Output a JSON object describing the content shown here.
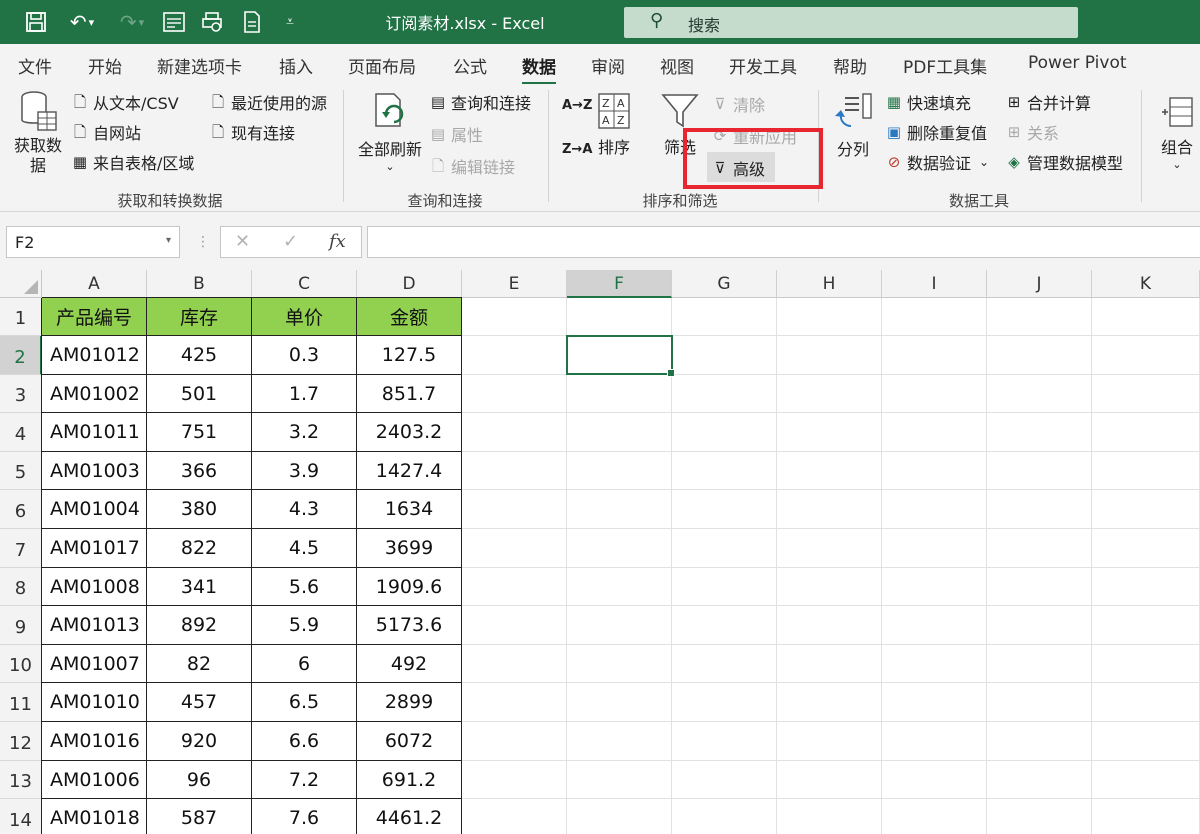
{
  "window": {
    "title": "订阅素材.xlsx - Excel",
    "search_placeholder": "搜索",
    "accent": "#217346"
  },
  "tabs": [
    "文件",
    "开始",
    "新建选项卡",
    "插入",
    "页面布局",
    "公式",
    "数据",
    "审阅",
    "视图",
    "开发工具",
    "帮助",
    "PDF工具集",
    "Power Pivot"
  ],
  "active_tab": "数据",
  "ribbon": {
    "get_data": {
      "big_label": "获取数据",
      "big_label_2": "据",
      "from_text": "从文本/CSV",
      "from_web": "自网站",
      "from_table": "来自表格/区域",
      "recent_sources": "最近使用的源",
      "existing_connections": "现有连接",
      "group_label": "获取和转换数据"
    },
    "queries": {
      "refresh_all": "全部刷新",
      "queries_connections": "查询和连接",
      "properties": "属性",
      "edit_links": "编辑链接",
      "group_label": "查询和连接"
    },
    "sort_filter": {
      "sort_az": "A→Z",
      "sort_za": "Z→A",
      "sort": "排序",
      "filter": "筛选",
      "clear": "清除",
      "reapply": "重新应用",
      "advanced": "高级",
      "group_label": "排序和筛选"
    },
    "data_tools": {
      "text_to_columns": "分列",
      "flash_fill": "快速填充",
      "remove_duplicates": "删除重复值",
      "data_validation": "数据验证",
      "consolidate": "合并计算",
      "relationships": "关系",
      "manage_data_model": "管理数据模型",
      "group_label": "数据工具"
    },
    "outline": {
      "group": "组合"
    }
  },
  "formula_bar": {
    "name_box": "F2",
    "cancel": "✕",
    "enter": "✓",
    "fx": "fx",
    "formula": ""
  },
  "columns": [
    "A",
    "B",
    "C",
    "D",
    "E",
    "F",
    "G",
    "H",
    "I",
    "J",
    "K"
  ],
  "selected_column": "F",
  "selected_row": "2",
  "rows": [
    "1",
    "2",
    "3",
    "4",
    "5",
    "6",
    "7",
    "8",
    "9",
    "10",
    "11",
    "12",
    "13",
    "14"
  ],
  "table": {
    "headers": [
      "产品编号",
      "库存",
      "单价",
      "金额"
    ],
    "header_color": "#92d050",
    "data": [
      [
        "AM01012",
        "425",
        "0.3",
        "127.5"
      ],
      [
        "AM01002",
        "501",
        "1.7",
        "851.7"
      ],
      [
        "AM01011",
        "751",
        "3.2",
        "2403.2"
      ],
      [
        "AM01003",
        "366",
        "3.9",
        "1427.4"
      ],
      [
        "AM01004",
        "380",
        "4.3",
        "1634"
      ],
      [
        "AM01017",
        "822",
        "4.5",
        "3699"
      ],
      [
        "AM01008",
        "341",
        "5.6",
        "1909.6"
      ],
      [
        "AM01013",
        "892",
        "5.9",
        "5173.6"
      ],
      [
        "AM01007",
        "82",
        "6",
        "492"
      ],
      [
        "AM01010",
        "457",
        "6.5",
        "2899"
      ],
      [
        "AM01016",
        "920",
        "6.6",
        "6072"
      ],
      [
        "AM01006",
        "96",
        "7.2",
        "691.2"
      ],
      [
        "AM01018",
        "587",
        "7.6",
        "4461.2"
      ]
    ]
  },
  "highlight_color": "#e8262f"
}
